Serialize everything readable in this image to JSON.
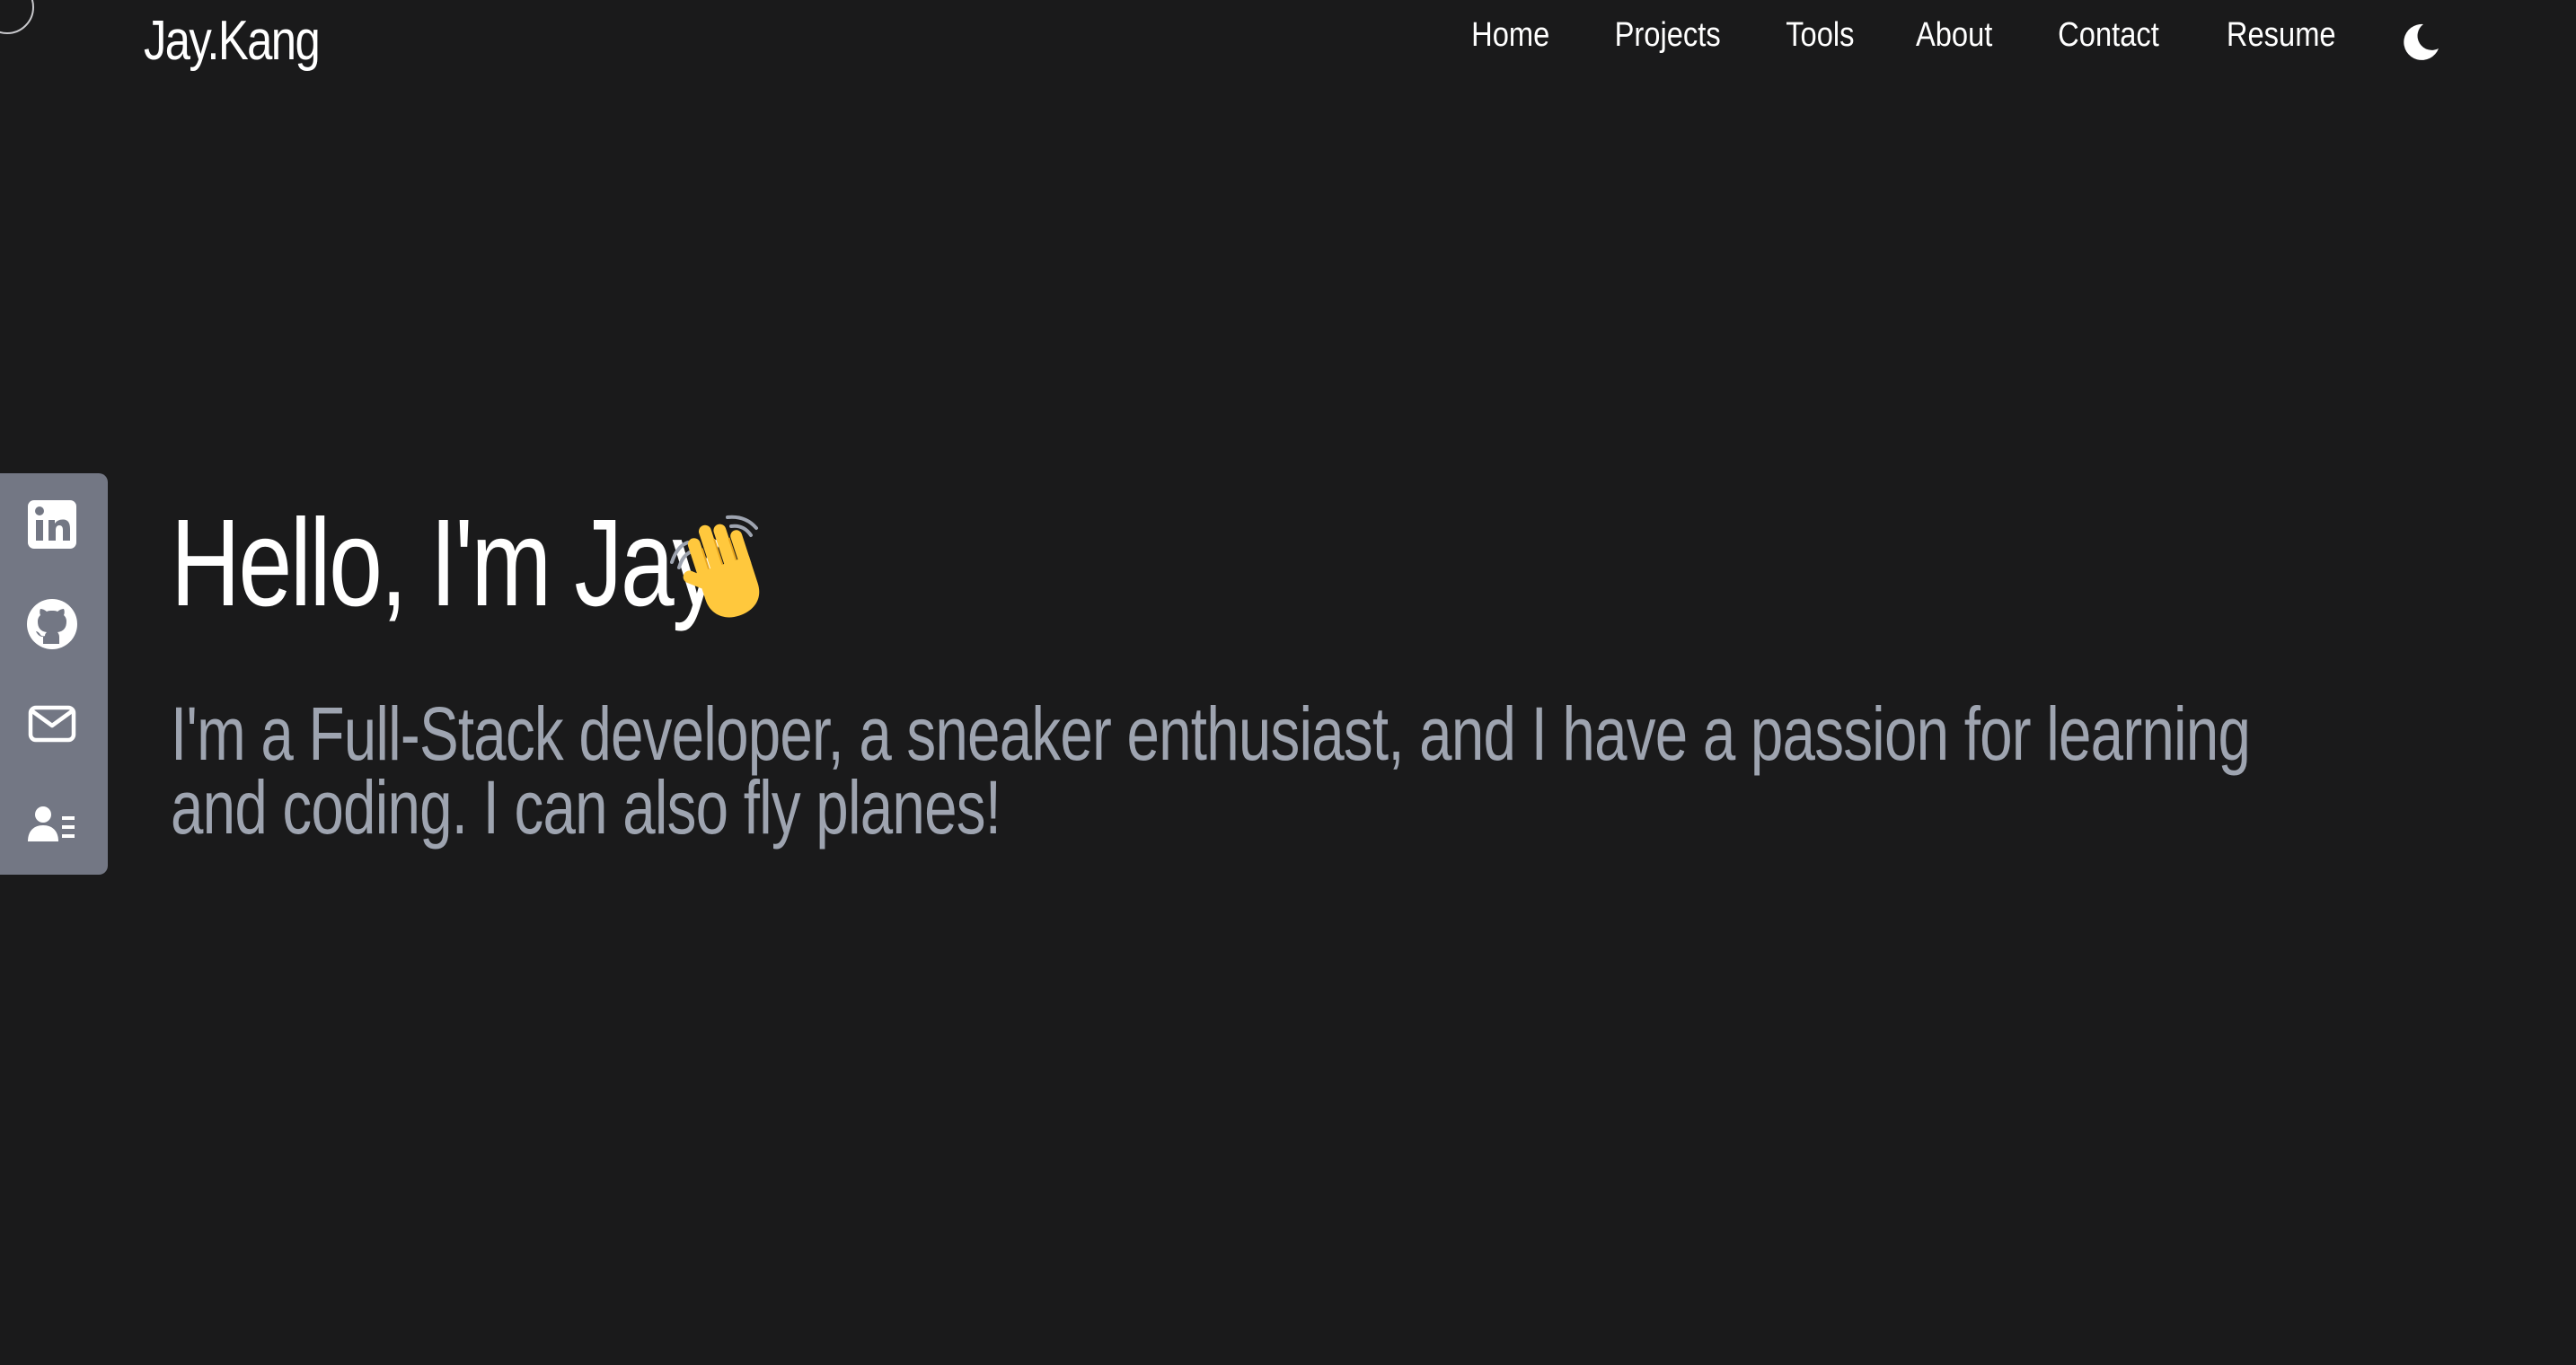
{
  "header": {
    "logo": "Jay.Kang",
    "nav": [
      {
        "label": "Home"
      },
      {
        "label": "Projects"
      },
      {
        "label": "Tools"
      },
      {
        "label": "About"
      },
      {
        "label": "Contact"
      },
      {
        "label": "Resume"
      }
    ],
    "theme_toggle_icon": "moon-icon"
  },
  "social": [
    {
      "icon": "linkedin-icon"
    },
    {
      "icon": "github-icon"
    },
    {
      "icon": "mail-icon"
    },
    {
      "icon": "contact-card-icon"
    }
  ],
  "hero": {
    "title": "Hello, I'm Jay",
    "title_icon": "waving-hand-icon",
    "subtitle": "I'm a Full-Stack developer, a sneaker enthusiast, and I have a passion for learning and coding. I can also fly planes!"
  },
  "colors": {
    "background": "#1a1a1b",
    "text": "#ffffff",
    "subtitle": "#9ea4b0",
    "social_bar": "#737784"
  }
}
